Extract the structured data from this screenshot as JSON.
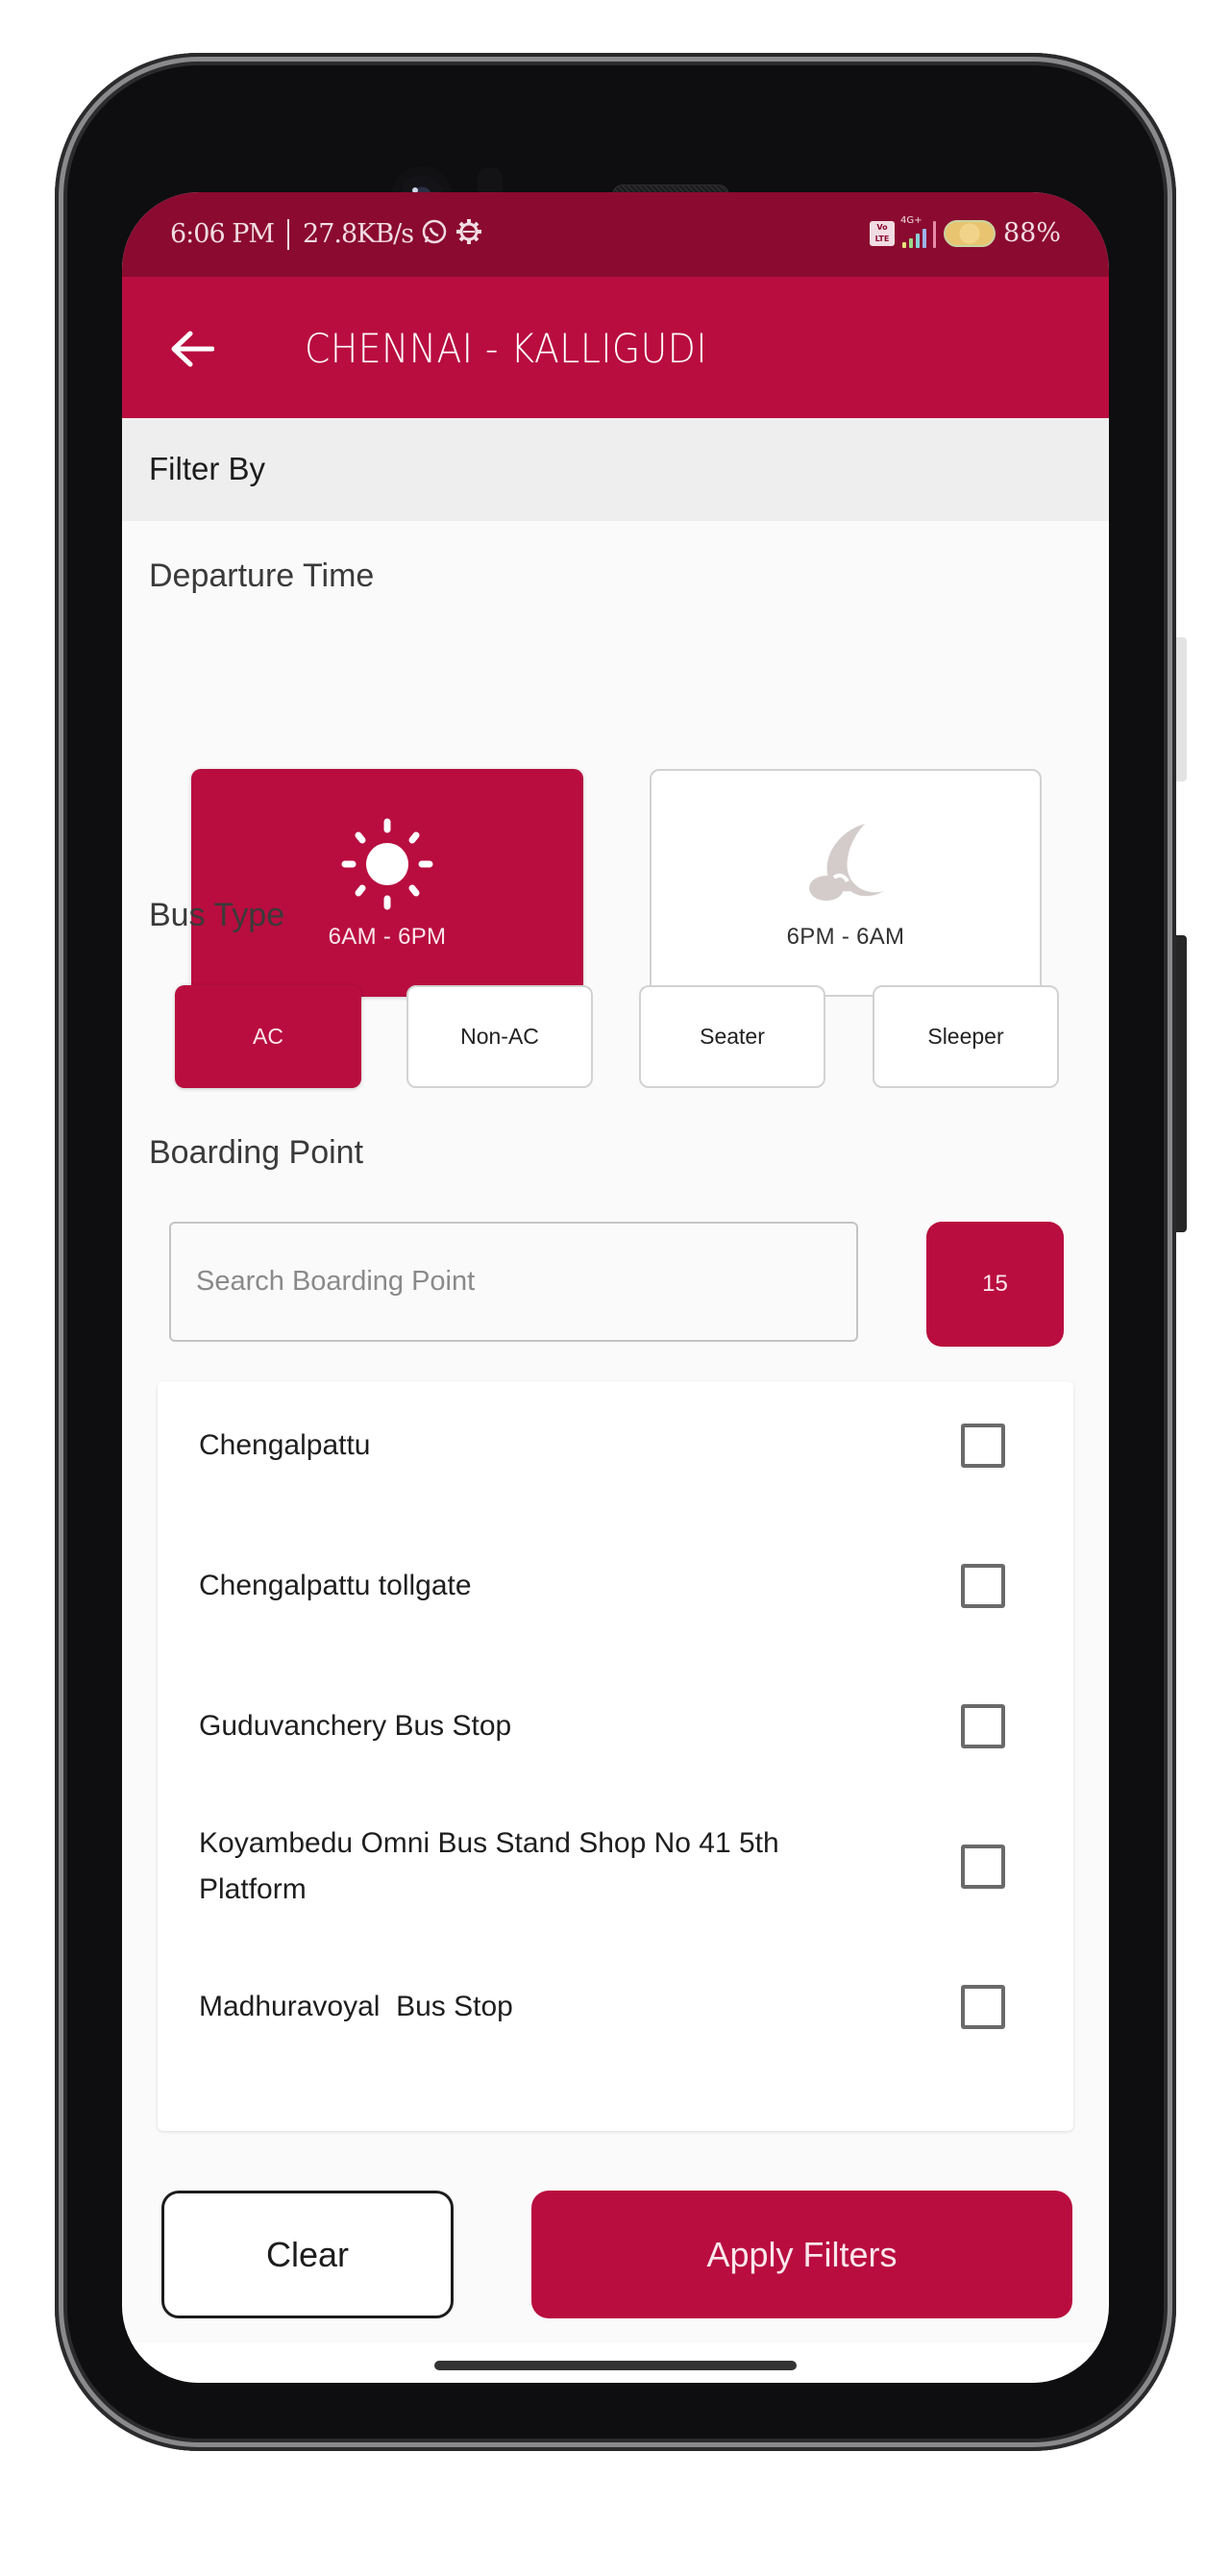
{
  "status_bar": {
    "time": "6:06 PM",
    "net_speed": "27.8KB/s",
    "icons_left": [
      "whatsapp-icon",
      "settings-gear-icon"
    ],
    "icons_right": [
      "volte-icon",
      "signal-4g-plus-icon",
      "battery-charging-icon"
    ],
    "volte": "Vo LTE",
    "network": "4G+",
    "battery": "88%"
  },
  "app_bar": {
    "back_icon": "arrow-left-icon",
    "title": "CHENNAI - KALLIGUDI"
  },
  "filter_header": "Filter By",
  "departure_time": {
    "label": "Departure Time",
    "options": [
      {
        "label": "6AM - 6PM",
        "icon": "sun-icon",
        "selected": true
      },
      {
        "label": "6PM - 6AM",
        "icon": "moon-icon",
        "selected": false
      }
    ]
  },
  "bus_type": {
    "label": "Bus Type",
    "options": [
      {
        "label": "AC",
        "selected": true
      },
      {
        "label": "Non-AC",
        "selected": false
      },
      {
        "label": "Seater",
        "selected": false
      },
      {
        "label": "Sleeper",
        "selected": false
      }
    ]
  },
  "boarding_point": {
    "label": "Boarding Point",
    "search_placeholder": "Search Boarding Point",
    "search_value": "",
    "count": "15",
    "items": [
      {
        "name": "Chengalpattu",
        "checked": false
      },
      {
        "name": "Chengalpattu tollgate",
        "checked": false
      },
      {
        "name": "Guduvanchery Bus Stop",
        "checked": false
      },
      {
        "name": "Koyambedu Omni Bus Stand Shop No 41 5th Platform",
        "checked": false
      },
      {
        "name": "Madhuravoyal  Bus Stop",
        "checked": false
      }
    ]
  },
  "actions": {
    "clear": "Clear",
    "apply": "Apply Filters"
  },
  "colors": {
    "primary": "#b90d3f",
    "status_bar": "#8b0a30",
    "filter_header_bg": "#eeeeee",
    "background": "#fafafa",
    "moon_icon": "#d3cccb"
  }
}
